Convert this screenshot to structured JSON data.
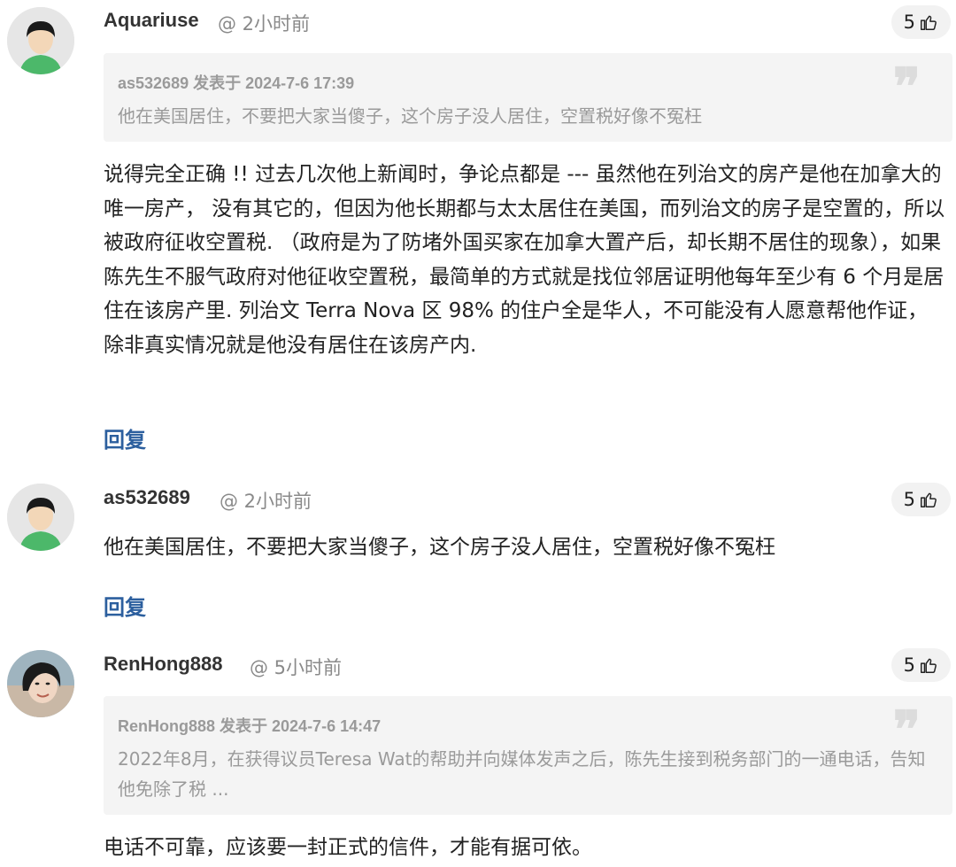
{
  "comments": [
    {
      "username": "Aquariuse",
      "timestamp": "@ 2小时前",
      "likes": "5",
      "avatar": "default-avatar",
      "quote": {
        "meta": "as532689 发表于 2024-7-6 17:39",
        "text": "他在美国居住，不要把大家当傻子，这个房子没人居住，空置税好像不冤枉"
      },
      "body": "说得完全正确 !! 过去几次他上新闻时，争论点都是 --- 虽然他在列治文的房产是他在加拿大的唯一房产， 没有其它的，但因为他长期都与太太居住在美国，而列治文的房子是空置的，所以被政府征收空置税. （政府是为了防堵外国买家在加拿大置产后，却长期不居住的现象），如果陈先生不服气政府对他征收空置税，最简单的方式就是找位邻居证明他每年至少有 6 个月是居住在该房产里. 列治文 Terra Nova 区 98% 的住户全是华人，不可能没有人愿意帮他作证， 除非真实情况就是他没有居住在该房产内.",
      "reply_label": "回复"
    },
    {
      "username": "as532689",
      "timestamp": "@ 2小时前",
      "likes": "5",
      "avatar": "default-avatar",
      "body": "他在美国居住，不要把大家当傻子，这个房子没人居住，空置税好像不冤枉",
      "reply_label": "回复"
    },
    {
      "username": "RenHong888",
      "timestamp": "@ 5小时前",
      "likes": "5",
      "avatar": "photo-avatar",
      "quote": {
        "meta": "RenHong888 发表于 2024-7-6 14:47",
        "text": "2022年8月，在获得议员Teresa Wat的帮助并向媒体发声之后，陈先生接到税务部门的一通电话，告知他免除了税 ..."
      },
      "body": "电话不可靠，应该要一封正式的信件，才能有据可依。"
    }
  ],
  "quote_mark": "❞",
  "colors": {
    "reply": "#2c5f9e",
    "quote_bg": "#f4f4f4",
    "likes_bg": "#f2f2f2"
  }
}
